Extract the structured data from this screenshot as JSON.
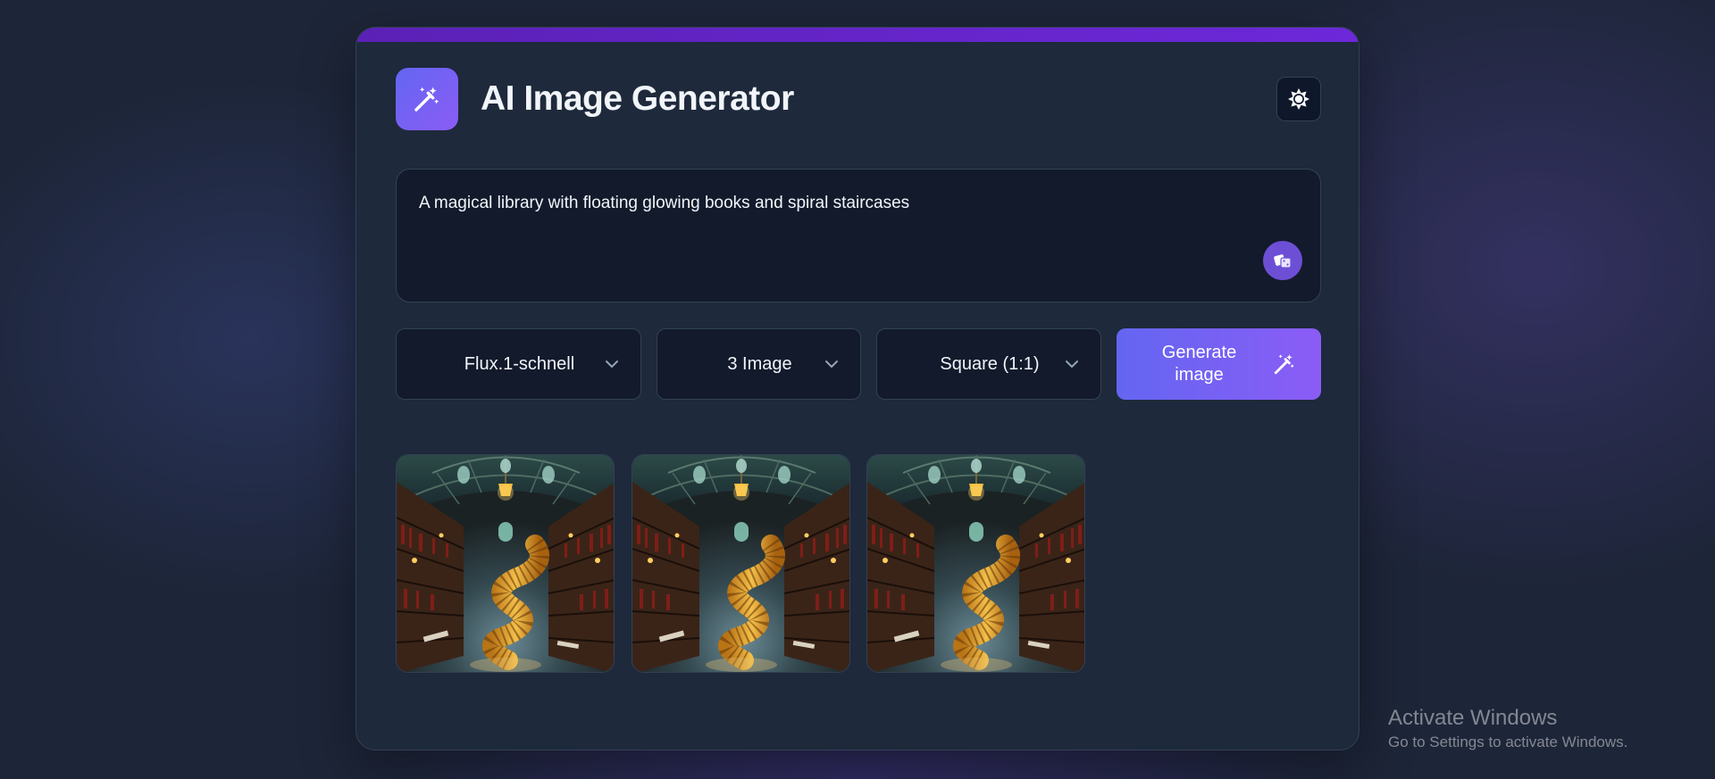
{
  "app": {
    "title": "AI Image Generator",
    "logo_icon": "magic-wand-icon",
    "theme_toggle_icon": "sun-icon",
    "accent_color": "#8b5cf6",
    "accent_bar_color": "#5b21b6"
  },
  "prompt": {
    "value": "A magical library with floating glowing books and spiral staircases",
    "random_icon": "dice-icon"
  },
  "controls": {
    "model": {
      "selected": "Flux.1-schnell",
      "icon": "chevron-down-icon"
    },
    "count": {
      "selected": "3 Image",
      "icon": "chevron-down-icon"
    },
    "ratio": {
      "selected": "Square (1:1)",
      "icon": "chevron-down-icon"
    },
    "generate": {
      "label": "Generate image",
      "icon": "magic-wand-icon"
    }
  },
  "gallery": {
    "images": [
      {
        "subject": "magical-library-spiral-staircase"
      },
      {
        "subject": "magical-library-spiral-staircase"
      },
      {
        "subject": "magical-library-spiral-staircase"
      }
    ]
  },
  "os_watermark": {
    "title": "Activate Windows",
    "subtitle": "Go to Settings to activate Windows."
  }
}
